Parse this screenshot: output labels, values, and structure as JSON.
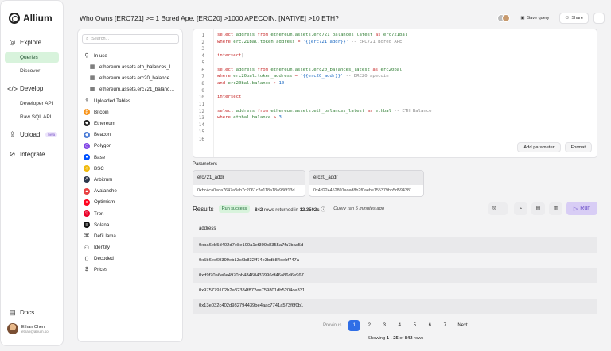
{
  "brand": {
    "name": "Allium"
  },
  "nav": {
    "explore": "Explore",
    "queries": "Queries",
    "discover": "Discover",
    "develop": "Develop",
    "developer_api": "Developer API",
    "raw_sql_api": "Raw SQL API",
    "upload": "Upload",
    "upload_badge": "beta",
    "integrate": "Integrate",
    "docs": "Docs"
  },
  "user": {
    "name": "Ethan Chen",
    "email": "ethan@allium.so"
  },
  "header": {
    "title": "Who Owns [ERC721] >= 1 Bored Ape, [ERC20] >1000 APECOIN, [NATIVE] >10 ETH?",
    "save_label": "Save query",
    "share_label": "Share",
    "more_label": "⋯"
  },
  "schema": {
    "search_placeholder": "Search...",
    "in_use": "In use",
    "in_use_tables": [
      "ethereum.assets.eth_balances_latest",
      "ethereum.assets.erc20_balances_latest",
      "ethereum.assets.erc721_balances_latest"
    ],
    "items": [
      {
        "label": "Uploaded Tables",
        "icon": "upload-icon"
      },
      {
        "label": "Bitcoin",
        "icon": "bitcoin-icon",
        "color": "#f7931a",
        "glyph": "₿"
      },
      {
        "label": "Ethereum",
        "icon": "ethereum-icon",
        "color": "#222222",
        "glyph": "◆"
      },
      {
        "label": "Beacon",
        "icon": "beacon-icon",
        "color": "#4a7bd6",
        "glyph": "◆"
      },
      {
        "label": "Polygon",
        "icon": "polygon-icon",
        "color": "#8247e5",
        "glyph": "⬡"
      },
      {
        "label": "Base",
        "icon": "base-icon",
        "color": "#0052ff",
        "glyph": "●"
      },
      {
        "label": "BSC",
        "icon": "bsc-icon",
        "color": "#f0b90b",
        "glyph": "◇"
      },
      {
        "label": "Arbitrum",
        "icon": "arbitrum-icon",
        "color": "#2d374b",
        "glyph": "A"
      },
      {
        "label": "Avalanche",
        "icon": "avalanche-icon",
        "color": "#e84142",
        "glyph": "▲"
      },
      {
        "label": "Optimism",
        "icon": "optimism-icon",
        "color": "#ff0420",
        "glyph": "o"
      },
      {
        "label": "Tron",
        "icon": "tron-icon",
        "color": "#eb0029",
        "glyph": "▽"
      },
      {
        "label": "Solana",
        "icon": "solana-icon",
        "color": "#111111",
        "glyph": "≡"
      },
      {
        "label": "DefiLlama",
        "icon": "defillama-icon"
      },
      {
        "label": "Identity",
        "icon": "identity-icon"
      },
      {
        "label": "Decoded",
        "icon": "decoded-icon"
      },
      {
        "label": "Prices",
        "icon": "prices-icon"
      }
    ]
  },
  "editor": {
    "line_numbers": [
      "1",
      "2",
      "3",
      "4",
      "5",
      "6",
      "7",
      "8",
      "9",
      "10",
      "11",
      "12",
      "13",
      "14",
      "15",
      "16"
    ],
    "add_parameter": "Add parameter",
    "format": "Format"
  },
  "parameters": {
    "label": "Parameters",
    "items": [
      {
        "name": "erc721_addr",
        "value": "0xbc4ca0eda7647a8ab7c2061c2e118a18a936f13d"
      },
      {
        "name": "erc20_addr",
        "value": "0x4d224452801aced8b2f0aebe155379bb5d594381"
      }
    ]
  },
  "results": {
    "title": "Results",
    "status": "Run success",
    "rows_count": "842",
    "rows_text": "rows returned in",
    "duration": "12.3502s",
    "ran": "Query ran 5 minutes ago",
    "run_label": "Run",
    "column": "address",
    "rows": [
      "0xba6eb5d402d7e8e100a1ef309c8355a7fa7bac5d",
      "0x5b6ec69399eb13c6b832ff74e3bdb84cebf747a",
      "0xd9f70a6e0e4970bb48460433996df46a86d6e967",
      "0x975779102b2a82384f872ee759801db5204ce331",
      "0x13e032c402d982794439be4aac7741a573f6f0b1"
    ]
  },
  "pagination": {
    "previous": "Previous",
    "pages": [
      "1",
      "2",
      "3",
      "4",
      "5",
      "6",
      "7"
    ],
    "next": "Next",
    "showing_prefix": "Showing",
    "range": "1 - 25",
    "of": "of",
    "total": "842",
    "rows": "rows"
  }
}
